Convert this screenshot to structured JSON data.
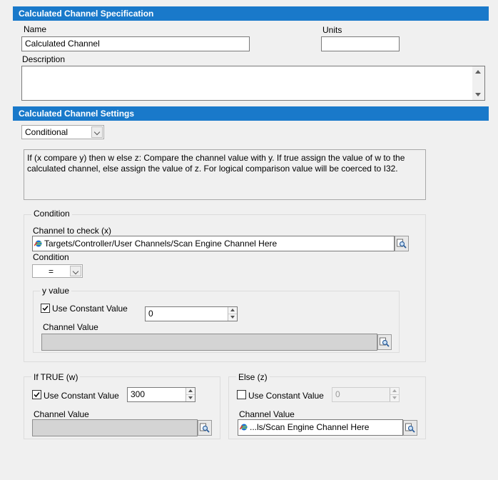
{
  "spec": {
    "header": "Calculated Channel Specification",
    "name_label": "Name",
    "name_value": "Calculated Channel",
    "units_label": "Units",
    "units_value": "",
    "description_label": "Description",
    "description_value": ""
  },
  "settings": {
    "header": "Calculated Channel Settings",
    "type_selected": "Conditional",
    "info_text": "If (x compare y) then w else z: Compare the channel value with y. If true assign the value of w to the calculated channel, else assign the value of z. For logical comparison value will be coerced to I32."
  },
  "condition": {
    "group_title": "Condition",
    "channel_label": "Channel to check (x)",
    "channel_value": "Targets/Controller/User Channels/Scan Engine Channel Here",
    "condition_label": "Condition",
    "condition_selected": "=",
    "y_group_title": "y value",
    "y_use_constant_label": "Use Constant Value",
    "y_use_constant_checked": true,
    "y_constant_value": "0",
    "y_channel_label": "Channel Value",
    "y_channel_value": ""
  },
  "if_true": {
    "group_title": "If TRUE (w)",
    "use_constant_label": "Use Constant Value",
    "use_constant_checked": true,
    "constant_value": "300",
    "channel_label": "Channel Value",
    "channel_value": ""
  },
  "else_z": {
    "group_title": "Else (z)",
    "use_constant_label": "Use Constant Value",
    "use_constant_checked": false,
    "constant_value": "0",
    "channel_label": "Channel Value",
    "channel_value": "...ls/Scan Engine Channel Here"
  },
  "colors": {
    "header_bg": "#1979ca",
    "window_bg": "#f0f0f0"
  }
}
